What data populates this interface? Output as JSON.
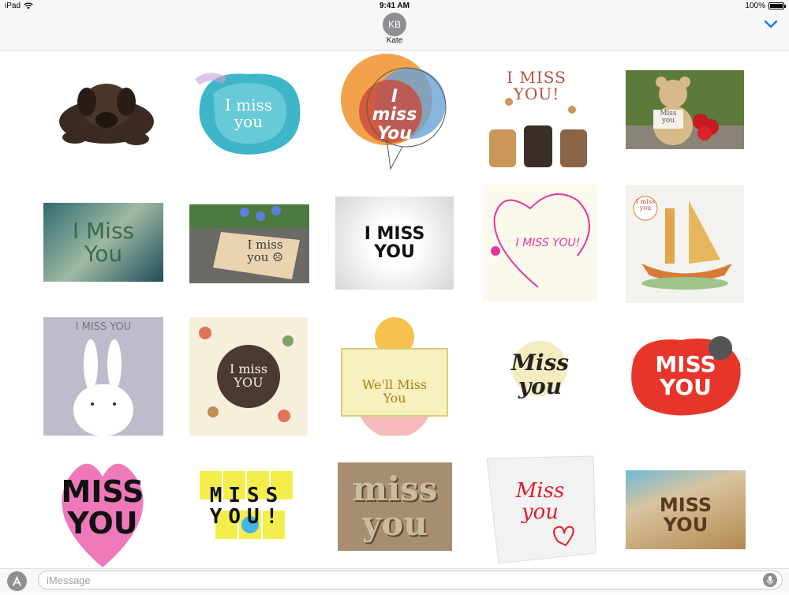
{
  "status_bar": {
    "device": "iPad",
    "time": "9:41 AM",
    "battery": "100%",
    "battery_level": 1.0
  },
  "header": {
    "avatar_initials": "KB",
    "contact_name": "Kate"
  },
  "stickers": [
    {
      "id": "puppy",
      "text": ""
    },
    {
      "id": "i-miss-you-watercolor",
      "text": "I miss you"
    },
    {
      "id": "i-miss-you-bubble",
      "text": "I miss You"
    },
    {
      "id": "i-miss-you-cats",
      "text": "I MISS YOU!"
    },
    {
      "id": "teddy-bear",
      "text": "Miss you"
    },
    {
      "id": "i-miss-you-glass",
      "text": "I Miss You"
    },
    {
      "id": "i-miss-you-tag",
      "text": "I miss you ☹"
    },
    {
      "id": "i-miss-you-ornate",
      "text": "I MISS YOU"
    },
    {
      "id": "i-miss-you-heart-line",
      "text": "I MISS YOU!"
    },
    {
      "id": "i-miss-you-boat",
      "text": "I miss you"
    },
    {
      "id": "i-miss-you-bunny",
      "text": "I MISS YOU"
    },
    {
      "id": "i-miss-you-floral",
      "text": "I miss YOU"
    },
    {
      "id": "well-miss-you-tiger",
      "text": "We'll Miss You"
    },
    {
      "id": "miss-you-script",
      "text": "Miss you"
    },
    {
      "id": "miss-you-red-splash",
      "text": "MISS YOU"
    },
    {
      "id": "miss-you-pink-heart",
      "text": "MISS YOU"
    },
    {
      "id": "miss-you-sticky-notes",
      "text": "MISS YOU!"
    },
    {
      "id": "miss-you-wood-type",
      "text": "miss you"
    },
    {
      "id": "miss-you-paper-note",
      "text": "Miss you"
    },
    {
      "id": "miss-you-sand",
      "text": "MISS YOU"
    }
  ],
  "input": {
    "placeholder": "iMessage",
    "value": ""
  },
  "icons": {
    "app_store": "app-store-icon",
    "mic": "microphone-icon",
    "collapse": "chevron-down-icon",
    "wifi": "wifi-icon",
    "battery": "battery-icon"
  },
  "colors": {
    "accent": "#0a7aff",
    "avatar": "#8e8e93"
  }
}
